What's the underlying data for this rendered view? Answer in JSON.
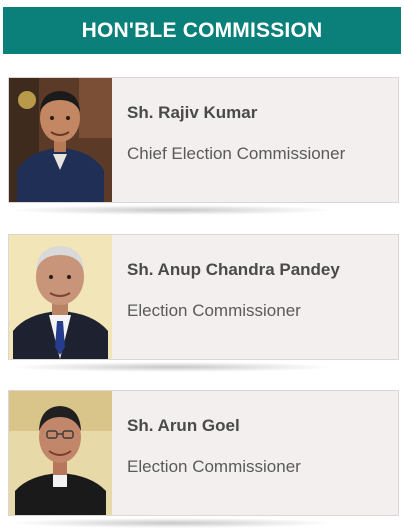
{
  "header": {
    "title": "HON'BLE COMMISSION"
  },
  "members": [
    {
      "name": "Sh. Rajiv Kumar",
      "role": "Chief Election Commissioner",
      "photo_icon": "portrait-photo"
    },
    {
      "name": "Sh. Anup Chandra Pandey",
      "role": "Election Commissioner",
      "photo_icon": "portrait-photo"
    },
    {
      "name": "Sh. Arun Goel",
      "role": "Election Commissioner",
      "photo_icon": "portrait-photo"
    }
  ],
  "colors": {
    "header_bg": "#0b7f7a",
    "header_text": "#ffffff",
    "card_bg": "#f4efef",
    "name_text": "#4a4a4a",
    "role_text": "#5a5a5a"
  }
}
